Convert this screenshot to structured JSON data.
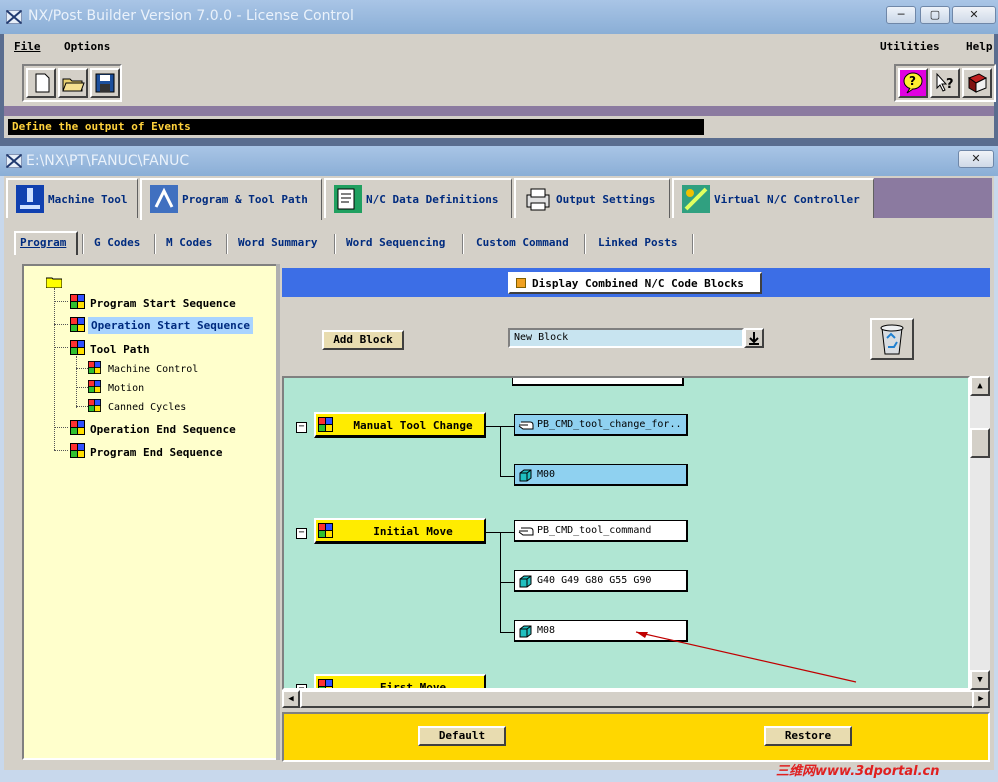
{
  "outer": {
    "title": "NX/Post Builder Version 7.0.0 - License Control",
    "menu": {
      "file": "File",
      "options": "Options",
      "utilities": "Utilities",
      "help": "Help"
    },
    "status": "Define the output of Events"
  },
  "inner": {
    "title": "E:\\NX\\PT\\FANUC\\FANUC",
    "tabs": [
      "Machine Tool",
      "Program & Tool Path",
      "N/C Data Definitions",
      "Output Settings",
      "Virtual N/C Controller"
    ],
    "subtabs": [
      "Program",
      "G Codes",
      "M Codes",
      "Word Summary",
      "Word Sequencing",
      "Custom Command",
      "Linked Posts"
    ],
    "tree": {
      "items": [
        "Program Start Sequence",
        "Operation Start Sequence",
        "Tool Path",
        "Operation End Sequence",
        "Program End Sequence"
      ],
      "sub": [
        "Machine Control",
        "Motion",
        "Canned Cycles"
      ]
    },
    "toggle_label": "Display Combined N/C Code Blocks",
    "add_block": "Add Block",
    "new_block": "New Block",
    "events": [
      {
        "name": "Manual Tool Change",
        "blocks": [
          "PB_CMD_tool_change_for...",
          "M00"
        ]
      },
      {
        "name": "Initial Move",
        "blocks": [
          "PB_CMD_tool_command",
          "G40 G49 G80 G55 G90",
          "M08"
        ]
      },
      {
        "name": "First Move"
      }
    ],
    "default_btn": "Default",
    "restore_btn": "Restore"
  },
  "watermark": "三维网www.3dportal.cn",
  "colors": {
    "canvas": "#b0e6d3",
    "event": "#ffec00",
    "tree_bg": "#ffffcc",
    "header_bar": "#3c6ee6",
    "footer": "#ffd700"
  }
}
